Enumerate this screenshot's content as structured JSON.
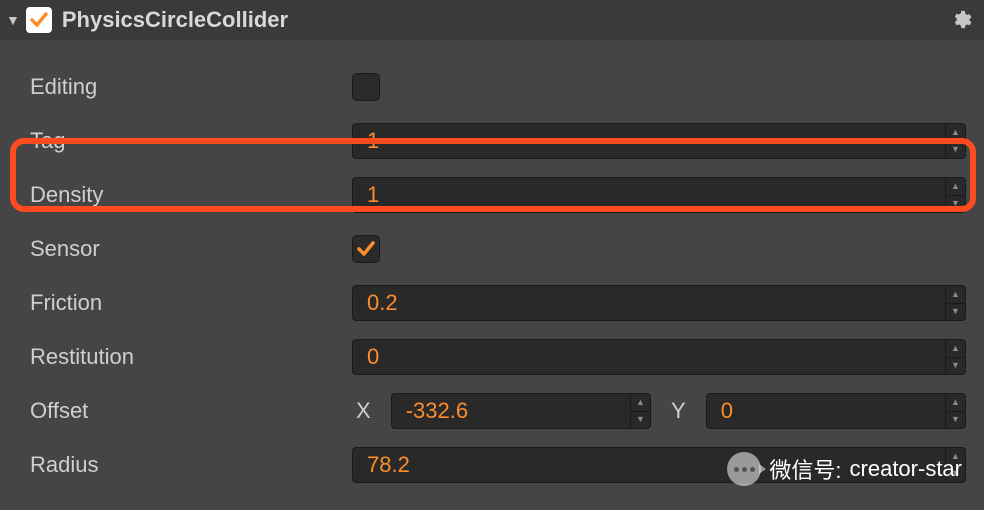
{
  "header": {
    "title": "PhysicsCircleCollider",
    "enabled": true
  },
  "fields": {
    "editing": {
      "label": "Editing",
      "checked": false
    },
    "tag": {
      "label": "Tag",
      "value": "1"
    },
    "density": {
      "label": "Density",
      "value": "1"
    },
    "sensor": {
      "label": "Sensor",
      "checked": true
    },
    "friction": {
      "label": "Friction",
      "value": "0.2"
    },
    "restitution": {
      "label": "Restitution",
      "value": "0"
    },
    "offset": {
      "label": "Offset",
      "xlabel": "X",
      "x": "-332.6",
      "ylabel": "Y",
      "y": "0"
    },
    "radius": {
      "label": "Radius",
      "value": "78.2"
    }
  },
  "watermark": {
    "prefix": "微信号:",
    "id": "creator-star"
  }
}
